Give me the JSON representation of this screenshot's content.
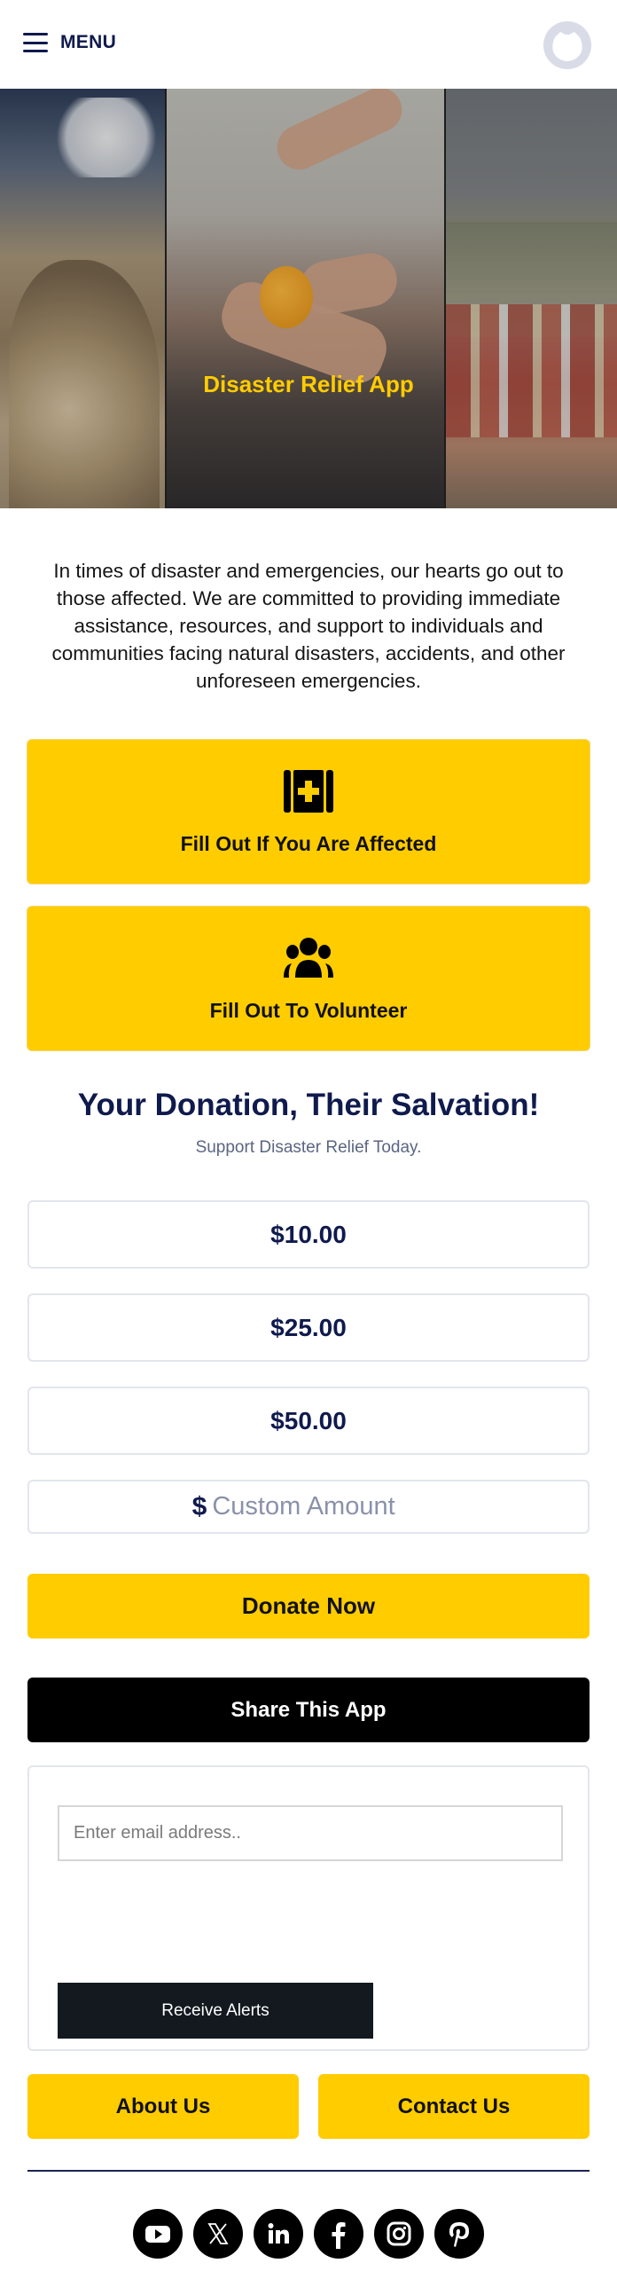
{
  "header": {
    "menu_label": "MENU",
    "menu_icon": "hamburger-icon",
    "avatar_icon": "user-avatar-icon"
  },
  "hero": {
    "title": "Disaster Relief App",
    "images": [
      "earthquake-rubble-image",
      "hands-food-aid-image",
      "refugee-tent-camp-image"
    ]
  },
  "intro": {
    "text": "In times of disaster and emergencies, our hearts go out to those affected. We are committed to providing immediate assistance, resources, and support to individuals and communities facing natural disasters, accidents, and other unforeseen emergencies."
  },
  "actions": [
    {
      "label": "Fill Out If You Are Affected",
      "icon": "first-aid-kit-icon"
    },
    {
      "label": "Fill Out To Volunteer",
      "icon": "group-people-icon"
    }
  ],
  "donation": {
    "title": "Your Donation, Their Salvation!",
    "subtitle": "Support Disaster Relief Today.",
    "amounts": [
      "$10.00",
      "$25.00",
      "$50.00"
    ],
    "custom_currency": "$",
    "custom_placeholder": "Custom Amount",
    "custom_value": "",
    "donate_label": "Donate Now"
  },
  "share": {
    "label": "Share This App"
  },
  "alerts": {
    "email_placeholder": "Enter email address..",
    "email_value": "",
    "button_label": "Receive Alerts"
  },
  "footer": {
    "about_label": "About Us",
    "contact_label": "Contact Us",
    "socials": [
      "youtube-icon",
      "x-twitter-icon",
      "linkedin-icon",
      "facebook-icon",
      "instagram-icon",
      "pinterest-icon"
    ]
  },
  "colors": {
    "accent_yellow": "#ffcc00",
    "navy": "#0f1a4d",
    "black": "#000000",
    "alerts_button": "#13191f"
  }
}
